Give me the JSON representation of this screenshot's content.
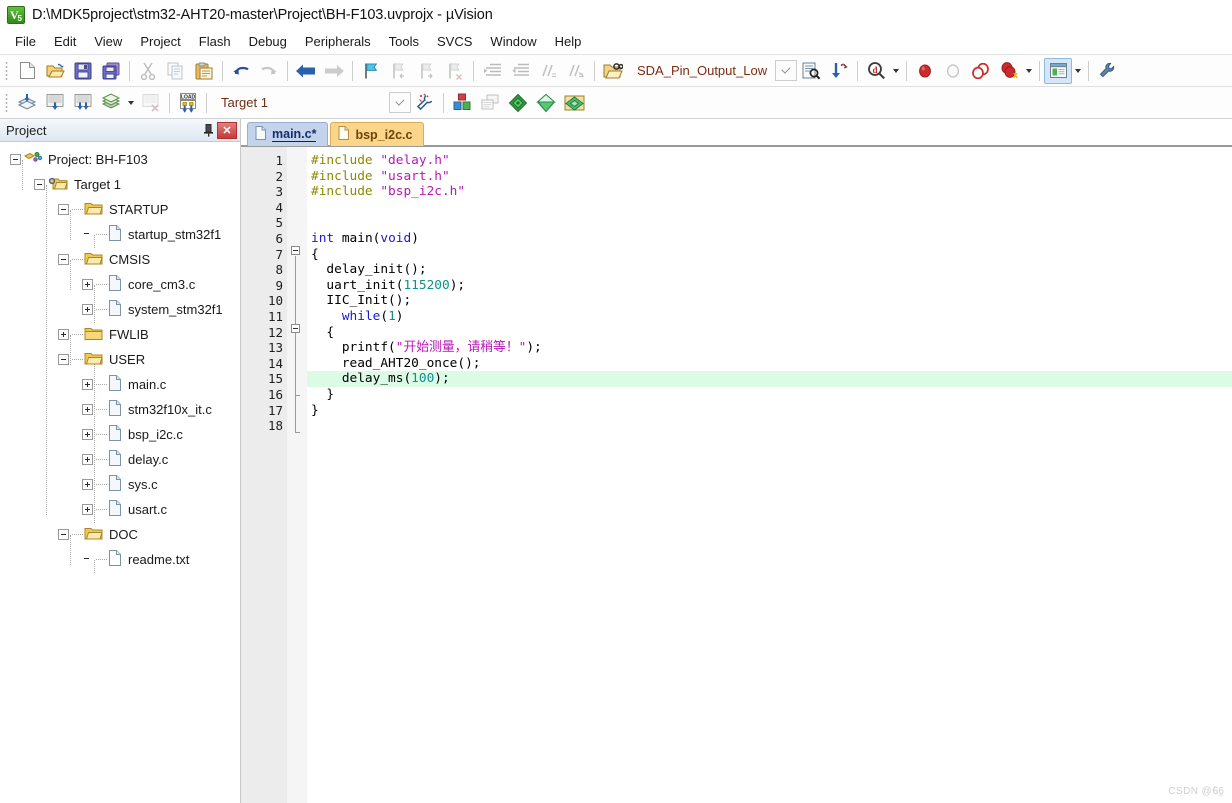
{
  "window": {
    "title": "D:\\MDK5project\\stm32-AHT20-master\\Project\\BH-F103.uvprojx - µVision",
    "app_icon": "uvision-logo-icon"
  },
  "menubar": {
    "items": [
      {
        "label": "File"
      },
      {
        "label": "Edit"
      },
      {
        "label": "View"
      },
      {
        "label": "Project"
      },
      {
        "label": "Flash"
      },
      {
        "label": "Debug"
      },
      {
        "label": "Peripherals"
      },
      {
        "label": "Tools"
      },
      {
        "label": "SVCS"
      },
      {
        "label": "Window"
      },
      {
        "label": "Help"
      }
    ]
  },
  "toolbar_file": {
    "buttons": [
      {
        "name": "new-file-icon",
        "tip": "New"
      },
      {
        "name": "open-file-icon",
        "tip": "Open"
      },
      {
        "name": "save-icon",
        "tip": "Save"
      },
      {
        "name": "save-all-icon",
        "tip": "Save All"
      },
      {
        "name": "cut-icon",
        "tip": "Cut"
      },
      {
        "name": "copy-icon",
        "tip": "Copy"
      },
      {
        "name": "paste-icon",
        "tip": "Paste"
      },
      {
        "name": "undo-icon",
        "tip": "Undo"
      },
      {
        "name": "redo-icon",
        "tip": "Redo"
      },
      {
        "name": "navigate-back-icon",
        "tip": "Back"
      },
      {
        "name": "navigate-forward-icon",
        "tip": "Forward"
      },
      {
        "name": "bookmark-toggle-icon",
        "tip": "Insert/Remove Bookmark"
      },
      {
        "name": "bookmark-prev-icon",
        "tip": "Previous Bookmark"
      },
      {
        "name": "bookmark-next-icon",
        "tip": "Next Bookmark"
      },
      {
        "name": "bookmark-clear-icon",
        "tip": "Clear All Bookmarks"
      },
      {
        "name": "indent-icon",
        "tip": "Indent"
      },
      {
        "name": "outdent-icon",
        "tip": "Outdent"
      },
      {
        "name": "comment-icon",
        "tip": "Comment"
      },
      {
        "name": "uncomment-icon",
        "tip": "Uncomment"
      },
      {
        "name": "find-in-files-icon",
        "tip": "Find in Files"
      }
    ],
    "find_combo_value": "SDA_Pin_Output_Low",
    "find_combo_placeholder": "",
    "right_buttons": [
      {
        "name": "find-icon",
        "tip": "Find"
      },
      {
        "name": "incremental-find-icon",
        "tip": "Incremental Find"
      },
      {
        "name": "magnify-browse-icon",
        "tip": "Browse"
      },
      {
        "name": "insert-breakpoint-icon",
        "tip": "Insert/Remove Breakpoint"
      },
      {
        "name": "enable-breakpoint-icon",
        "tip": "Enable/Disable Breakpoint"
      },
      {
        "name": "disable-all-breakpoints-icon",
        "tip": "Disable All Breakpoints"
      },
      {
        "name": "kill-all-breakpoints-icon",
        "tip": "Kill All Breakpoints"
      },
      {
        "name": "manage-windows-icon",
        "tip": "Manage Window Layouts"
      },
      {
        "name": "configure-icon",
        "tip": "Configuration Wizard"
      }
    ]
  },
  "toolbar_build": {
    "buttons": [
      {
        "name": "translate-icon",
        "tip": "Translate"
      },
      {
        "name": "build-icon",
        "tip": "Build"
      },
      {
        "name": "rebuild-icon",
        "tip": "Rebuild"
      },
      {
        "name": "batch-build-icon",
        "tip": "Batch Build"
      },
      {
        "name": "stop-build-icon",
        "tip": "Stop Build"
      },
      {
        "name": "download-icon",
        "tip": "Download"
      }
    ],
    "target_value": "Target 1",
    "right_buttons": [
      {
        "name": "target-options-icon",
        "tip": "Options for Target"
      },
      {
        "name": "manage-components-icon",
        "tip": "Manage Project Items"
      },
      {
        "name": "multi-project-icon",
        "tip": "Multi-Project"
      },
      {
        "name": "pack-installer-icon",
        "tip": "Pack Installer"
      },
      {
        "name": "manage-run-environment-icon",
        "tip": "Manage Run-Time Environment"
      },
      {
        "name": "select-software-packs-icon",
        "tip": "Select Software Packs"
      }
    ]
  },
  "project_panel": {
    "title": "Project",
    "pin_icon": "pin-icon",
    "close_icon": "close-icon",
    "tree": [
      {
        "label": "Project: BH-F103",
        "depth": 0,
        "toggle": "minus",
        "icon": "project-icon"
      },
      {
        "label": "Target 1",
        "depth": 1,
        "toggle": "minus",
        "icon": "target-icon"
      },
      {
        "label": "STARTUP",
        "depth": 2,
        "toggle": "minus",
        "icon": "folder-icon"
      },
      {
        "label": "startup_stm32f1",
        "depth": 3,
        "toggle": "none",
        "icon": "file-icon"
      },
      {
        "label": "CMSIS",
        "depth": 2,
        "toggle": "minus",
        "icon": "folder-icon"
      },
      {
        "label": "core_cm3.c",
        "depth": 3,
        "toggle": "plus",
        "icon": "file-icon"
      },
      {
        "label": "system_stm32f1",
        "depth": 3,
        "toggle": "plus",
        "icon": "file-icon"
      },
      {
        "label": "FWLIB",
        "depth": 2,
        "toggle": "plus",
        "icon": "folder-icon"
      },
      {
        "label": "USER",
        "depth": 2,
        "toggle": "minus",
        "icon": "folder-icon"
      },
      {
        "label": "main.c",
        "depth": 3,
        "toggle": "plus",
        "icon": "file-icon"
      },
      {
        "label": "stm32f10x_it.c",
        "depth": 3,
        "toggle": "plus",
        "icon": "file-icon"
      },
      {
        "label": "bsp_i2c.c",
        "depth": 3,
        "toggle": "plus",
        "icon": "file-icon"
      },
      {
        "label": "delay.c",
        "depth": 3,
        "toggle": "plus",
        "icon": "file-icon"
      },
      {
        "label": "sys.c",
        "depth": 3,
        "toggle": "plus",
        "icon": "file-icon"
      },
      {
        "label": "usart.c",
        "depth": 3,
        "toggle": "plus",
        "icon": "file-icon"
      },
      {
        "label": "DOC",
        "depth": 2,
        "toggle": "minus",
        "icon": "folder-icon"
      },
      {
        "label": "readme.txt",
        "depth": 3,
        "toggle": "none",
        "icon": "file-icon"
      }
    ]
  },
  "editor": {
    "tabs": [
      {
        "label": "main.c*",
        "selected": true
      },
      {
        "label": "bsp_i2c.c",
        "selected": false
      }
    ],
    "line_numbers": [
      1,
      2,
      3,
      4,
      5,
      6,
      7,
      8,
      9,
      10,
      11,
      12,
      13,
      14,
      15,
      16,
      17,
      18
    ],
    "highlighted_line": 15,
    "lines": [
      {
        "n": 1,
        "tokens": [
          {
            "t": "#include ",
            "c": "pre"
          },
          {
            "t": "\"delay.h\"",
            "c": "str"
          }
        ]
      },
      {
        "n": 2,
        "tokens": [
          {
            "t": "#include ",
            "c": "pre"
          },
          {
            "t": "\"usart.h\"",
            "c": "str"
          }
        ]
      },
      {
        "n": 3,
        "tokens": [
          {
            "t": "#include ",
            "c": "pre"
          },
          {
            "t": "\"bsp_i2c.h\"",
            "c": "str"
          }
        ]
      },
      {
        "n": 4,
        "tokens": []
      },
      {
        "n": 5,
        "tokens": []
      },
      {
        "n": 6,
        "tokens": [
          {
            "t": "int",
            "c": "kw"
          },
          {
            "t": " main(",
            "c": "pln"
          },
          {
            "t": "void",
            "c": "kw"
          },
          {
            "t": ")",
            "c": "pln"
          }
        ]
      },
      {
        "n": 7,
        "tokens": [
          {
            "t": "{",
            "c": "pln"
          }
        ]
      },
      {
        "n": 8,
        "tokens": [
          {
            "t": "  delay_init();",
            "c": "pln"
          }
        ]
      },
      {
        "n": 9,
        "tokens": [
          {
            "t": "  uart_init(",
            "c": "pln"
          },
          {
            "t": "115200",
            "c": "num"
          },
          {
            "t": ");",
            "c": "pln"
          }
        ]
      },
      {
        "n": 10,
        "tokens": [
          {
            "t": "  IIC_Init();",
            "c": "pln"
          }
        ]
      },
      {
        "n": 11,
        "tokens": [
          {
            "t": "    ",
            "c": "pln"
          },
          {
            "t": "while",
            "c": "kw"
          },
          {
            "t": "(",
            "c": "pln"
          },
          {
            "t": "1",
            "c": "num"
          },
          {
            "t": ")",
            "c": "pln"
          }
        ]
      },
      {
        "n": 12,
        "tokens": [
          {
            "t": "  {",
            "c": "pln"
          }
        ]
      },
      {
        "n": 13,
        "tokens": [
          {
            "t": "    printf(",
            "c": "pln"
          },
          {
            "t": "\"开始测量，请稍等！\"",
            "c": "str"
          },
          {
            "t": ");",
            "c": "pln"
          }
        ]
      },
      {
        "n": 14,
        "tokens": [
          {
            "t": "    read_AHT20_once();",
            "c": "pln"
          }
        ]
      },
      {
        "n": 15,
        "tokens": [
          {
            "t": "    delay_ms(",
            "c": "pln"
          },
          {
            "t": "100",
            "c": "num"
          },
          {
            "t": ");",
            "c": "pln"
          }
        ]
      },
      {
        "n": 16,
        "tokens": [
          {
            "t": "  }",
            "c": "pln"
          }
        ]
      },
      {
        "n": 17,
        "tokens": [
          {
            "t": "}",
            "c": "pln"
          }
        ]
      },
      {
        "n": 18,
        "tokens": []
      }
    ]
  },
  "watermark": {
    "text": "CSDN @6ٍ6"
  },
  "colors": {
    "tab_selected_bg": "#c3d3ec",
    "tab_unselected_bg": "#fbd589",
    "line_highlight": "#dcfbe4",
    "gutter_bg": "#ececec",
    "keyword": "#1a1ad2",
    "string": "#b817b8",
    "preprocessor": "#8a8a00",
    "number": "#0f8f8f",
    "toolbar_text": "#7a2d12"
  }
}
